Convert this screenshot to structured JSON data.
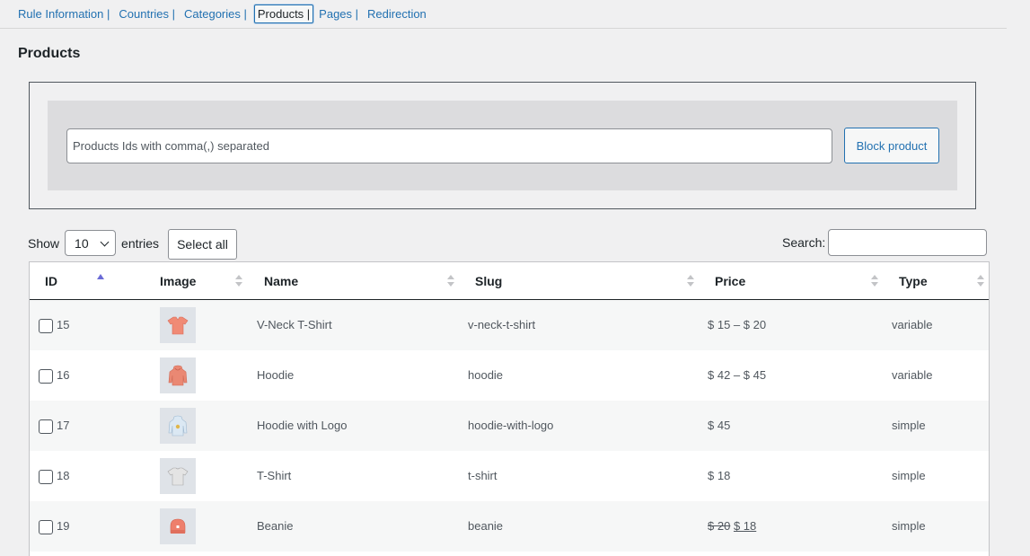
{
  "tabs": [
    {
      "label": "Rule Information |"
    },
    {
      "label": "Countries |"
    },
    {
      "label": "Categories |"
    },
    {
      "label": "Products |"
    },
    {
      "label": "Pages |"
    },
    {
      "label": "Redirection"
    }
  ],
  "active_tab": "Products |",
  "page_title": "Products",
  "block_form": {
    "input_placeholder": "Products Ids with comma(,) separated",
    "input_value": "",
    "button_label": "Block product"
  },
  "controls": {
    "show_label": "Show",
    "entries_value": "10",
    "entries_label": "entries",
    "select_all_label": "Select all",
    "search_label": "Search:",
    "search_value": ""
  },
  "table": {
    "columns": [
      "ID",
      "Image",
      "Name",
      "Slug",
      "Price",
      "Type"
    ],
    "sorted_column": "ID",
    "sort_direction": "ascending",
    "rows": [
      {
        "id": "15",
        "image": "v-neck-tshirt-thumbnail",
        "image_color": "#f08a75",
        "name": "V-Neck T-Shirt",
        "slug": "v-neck-t-shirt",
        "price": "$ 15 – $ 20",
        "price_old": "",
        "price_new": "",
        "type": "variable"
      },
      {
        "id": "16",
        "image": "hoodie-thumbnail",
        "image_color": "#ea8873",
        "name": "Hoodie",
        "slug": "hoodie",
        "price": "$ 42 – $ 45",
        "price_old": "",
        "price_new": "",
        "type": "variable"
      },
      {
        "id": "17",
        "image": "hoodie-with-logo-thumbnail",
        "image_color": "#b9cfe2",
        "name": "Hoodie with Logo",
        "slug": "hoodie-with-logo",
        "price": "$ 45",
        "price_old": "",
        "price_new": "",
        "type": "simple"
      },
      {
        "id": "18",
        "image": "tshirt-thumbnail",
        "image_color": "#c9c9c9",
        "name": "T-Shirt",
        "slug": "t-shirt",
        "price": "$ 18",
        "price_old": "",
        "price_new": "",
        "type": "simple"
      },
      {
        "id": "19",
        "image": "beanie-thumbnail",
        "image_color": "#ee7f6c",
        "name": "Beanie",
        "slug": "beanie",
        "price": "",
        "price_old": "$ 20",
        "price_new": "$ 18",
        "type": "simple"
      }
    ]
  }
}
